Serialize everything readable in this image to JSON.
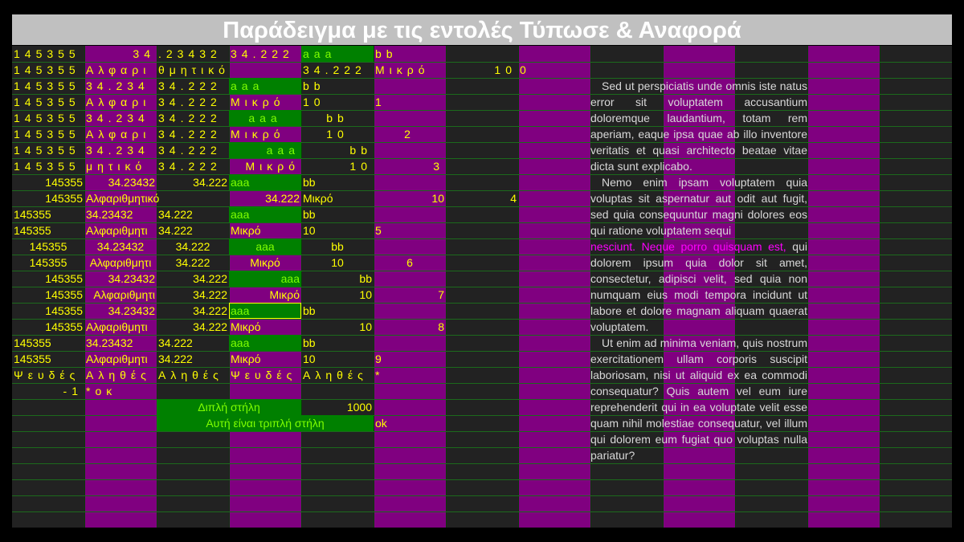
{
  "title": "Παράδειγμα με τις εντολές Τύπωσε & Αναφορά",
  "rows": [
    [
      {
        "c": 0,
        "t": "145355",
        "cls": "sp"
      },
      {
        "c": 1,
        "t": "34",
        "al": "r",
        "cls": "sp"
      },
      {
        "c": 2,
        "t": ".23432",
        "cls": "sp"
      },
      {
        "c": 3,
        "t": "34.222",
        "cls": "sp"
      },
      {
        "c": 4,
        "t": "aaa",
        "cls": "g sp"
      },
      {
        "c": 5,
        "t": "bb",
        "cls": "sp"
      }
    ],
    [
      {
        "c": 0,
        "t": "145355",
        "cls": "sp"
      },
      {
        "c": 1,
        "t": "Αλφαρι",
        "cls": "sp"
      },
      {
        "c": 2,
        "t": "θμητικό",
        "cls": "sp"
      },
      {
        "c": 4,
        "t": "34.222",
        "cls": "sp"
      },
      {
        "c": 5,
        "t": "Μικρό",
        "cls": "sp"
      },
      {
        "c": 6,
        "t": "10",
        "al": "r",
        "cls": "sp"
      },
      {
        "c": 7,
        "t": "0",
        "cls": "sp"
      }
    ],
    [
      {
        "c": 0,
        "t": "145355",
        "cls": "sp"
      },
      {
        "c": 1,
        "t": "34.234",
        "cls": "sp"
      },
      {
        "c": 2,
        "t": "34.222",
        "cls": "sp"
      },
      {
        "c": 3,
        "t": "aaa",
        "cls": "g sp"
      },
      {
        "c": 4,
        "t": "bb",
        "cls": "sp"
      }
    ],
    [
      {
        "c": 0,
        "t": "145355",
        "cls": "sp"
      },
      {
        "c": 1,
        "t": "Αλφαρι",
        "cls": "sp"
      },
      {
        "c": 2,
        "t": "34.222",
        "cls": "sp"
      },
      {
        "c": 3,
        "t": "Μικρό",
        "cls": "sp"
      },
      {
        "c": 4,
        "t": "10",
        "cls": "sp"
      },
      {
        "c": 5,
        "t": "1",
        "cls": "sp"
      }
    ],
    [
      {
        "c": 0,
        "t": "145355",
        "cls": "sp"
      },
      {
        "c": 1,
        "t": "34.234",
        "cls": "sp"
      },
      {
        "c": 2,
        "t": "34.222",
        "cls": "sp"
      },
      {
        "c": 3,
        "t": "aaa",
        "al": "c",
        "cls": "g sp"
      },
      {
        "c": 4,
        "t": "bb",
        "al": "c",
        "cls": "sp"
      }
    ],
    [
      {
        "c": 0,
        "t": "145355",
        "cls": "sp"
      },
      {
        "c": 1,
        "t": "Αλφαρι",
        "cls": "sp"
      },
      {
        "c": 2,
        "t": "34.222",
        "cls": "sp"
      },
      {
        "c": 3,
        "t": "Μικρό",
        "cls": "sp"
      },
      {
        "c": 4,
        "t": "10",
        "al": "c",
        "cls": "sp"
      },
      {
        "c": 5,
        "t": "2",
        "al": "c",
        "cls": "sp"
      }
    ],
    [
      {
        "c": 0,
        "t": "145355",
        "cls": "sp"
      },
      {
        "c": 1,
        "t": "34.234",
        "cls": "sp"
      },
      {
        "c": 2,
        "t": "34.222",
        "cls": "sp"
      },
      {
        "c": 3,
        "t": "aaa",
        "al": "r",
        "cls": "g sp"
      },
      {
        "c": 4,
        "t": "bb",
        "al": "r",
        "cls": "sp"
      }
    ],
    [
      {
        "c": 0,
        "t": "145355",
        "cls": "sp"
      },
      {
        "c": 1,
        "t": "μητικό",
        "cls": "sp"
      },
      {
        "c": 2,
        "t": "34.222",
        "cls": "sp"
      },
      {
        "c": 3,
        "t": "Μικρό",
        "al": "r",
        "cls": "sp"
      },
      {
        "c": 4,
        "t": "10",
        "al": "r",
        "cls": "sp"
      },
      {
        "c": 5,
        "t": "3",
        "al": "r",
        "cls": "sp"
      }
    ],
    [
      {
        "c": 0,
        "t": "145355",
        "al": "r"
      },
      {
        "c": 1,
        "t": "34.23432",
        "al": "r"
      },
      {
        "c": 2,
        "t": "34.222",
        "al": "r"
      },
      {
        "c": 3,
        "t": "aaa",
        "cls": "g"
      },
      {
        "c": 4,
        "t": "bb"
      }
    ],
    [
      {
        "c": 0,
        "t": "145355",
        "al": "r"
      },
      {
        "c": 1,
        "t": "Αλφαριθμητικό"
      },
      {
        "c": 3,
        "t": "34.222",
        "al": "r"
      },
      {
        "c": 4,
        "t": "Μικρό"
      },
      {
        "c": 5,
        "t": "10",
        "al": "r"
      },
      {
        "c": 6,
        "t": "4",
        "al": "r"
      }
    ],
    [
      {
        "c": 0,
        "t": "145355"
      },
      {
        "c": 1,
        "t": "34.23432"
      },
      {
        "c": 2,
        "t": "34.222"
      },
      {
        "c": 3,
        "t": "aaa",
        "cls": "g"
      },
      {
        "c": 4,
        "t": "bb"
      }
    ],
    [
      {
        "c": 0,
        "t": "145355"
      },
      {
        "c": 1,
        "t": "Αλφαριθμητι"
      },
      {
        "c": 2,
        "t": "34.222"
      },
      {
        "c": 3,
        "t": "Μικρό"
      },
      {
        "c": 4,
        "t": "10"
      },
      {
        "c": 5,
        "t": "5"
      }
    ],
    [
      {
        "c": 0,
        "t": "145355",
        "al": "c"
      },
      {
        "c": 1,
        "t": "34.23432",
        "al": "c"
      },
      {
        "c": 2,
        "t": "34.222",
        "al": "c"
      },
      {
        "c": 3,
        "t": "aaa",
        "al": "c",
        "cls": "g"
      },
      {
        "c": 4,
        "t": "bb",
        "al": "c"
      }
    ],
    [
      {
        "c": 0,
        "t": "145355",
        "al": "c"
      },
      {
        "c": 1,
        "t": "Αλφαριθμητι",
        "al": "c"
      },
      {
        "c": 2,
        "t": "34.222",
        "al": "c"
      },
      {
        "c": 3,
        "t": "Μικρό",
        "al": "c"
      },
      {
        "c": 4,
        "t": "10",
        "al": "c"
      },
      {
        "c": 5,
        "t": "6",
        "al": "c"
      }
    ],
    [
      {
        "c": 0,
        "t": "145355",
        "al": "r"
      },
      {
        "c": 1,
        "t": "34.23432",
        "al": "r"
      },
      {
        "c": 2,
        "t": "34.222",
        "al": "r"
      },
      {
        "c": 3,
        "t": "aaa",
        "al": "r",
        "cls": "g"
      },
      {
        "c": 4,
        "t": "bb",
        "al": "r"
      }
    ],
    [
      {
        "c": 0,
        "t": "145355",
        "al": "r"
      },
      {
        "c": 1,
        "t": "Αλφαριθμητι",
        "al": "r"
      },
      {
        "c": 2,
        "t": "34.222",
        "al": "r"
      },
      {
        "c": 3,
        "t": "Μικρό",
        "al": "r"
      },
      {
        "c": 4,
        "t": "10",
        "al": "r"
      },
      {
        "c": 5,
        "t": "7",
        "al": "r"
      }
    ],
    [
      {
        "c": 0,
        "t": "145355",
        "al": "r"
      },
      {
        "c": 1,
        "t": "34.23432",
        "al": "r"
      },
      {
        "c": 2,
        "t": "34.222",
        "al": "r"
      },
      {
        "c": 3,
        "t": "aaa",
        "cls": "g bx"
      },
      {
        "c": 4,
        "t": "bb"
      }
    ],
    [
      {
        "c": 0,
        "t": "145355",
        "al": "r"
      },
      {
        "c": 1,
        "t": "Αλφαριθμητι"
      },
      {
        "c": 2,
        "t": "34.222",
        "al": "r"
      },
      {
        "c": 3,
        "t": "Μικρό"
      },
      {
        "c": 4,
        "t": "10",
        "al": "r"
      },
      {
        "c": 5,
        "t": "8",
        "al": "r"
      }
    ],
    [
      {
        "c": 0,
        "t": "145355"
      },
      {
        "c": 1,
        "t": "34.23432"
      },
      {
        "c": 2,
        "t": "34.222"
      },
      {
        "c": 3,
        "t": "aaa",
        "cls": "g"
      },
      {
        "c": 4,
        "t": "bb"
      }
    ],
    [
      {
        "c": 0,
        "t": "145355"
      },
      {
        "c": 1,
        "t": "Αλφαριθμητι"
      },
      {
        "c": 2,
        "t": "34.222"
      },
      {
        "c": 3,
        "t": "Μικρό"
      },
      {
        "c": 4,
        "t": "10"
      },
      {
        "c": 5,
        "t": "9"
      }
    ],
    [
      {
        "c": 0,
        "t": "Ψευδές",
        "cls": "sp"
      },
      {
        "c": 1,
        "t": "Αληθές",
        "cls": "sp"
      },
      {
        "c": 2,
        "t": "Αληθές",
        "cls": "sp"
      },
      {
        "c": 3,
        "t": "Ψευδές",
        "cls": "sp"
      },
      {
        "c": 4,
        "t": "Αληθές",
        "cls": "sp"
      },
      {
        "c": 5,
        "t": "*"
      }
    ],
    [
      {
        "c": 0,
        "t": "-1",
        "al": "r",
        "cls": "sp"
      },
      {
        "c": 1,
        "t": "*οκ",
        "cls": "sp"
      }
    ],
    [
      {
        "c": 2,
        "span": 2,
        "t": "Διπλή στήλη",
        "al": "c",
        "cls": "gl"
      },
      {
        "c": 4,
        "t": "1000",
        "al": "r"
      }
    ],
    [
      {
        "c": 2,
        "span": 3,
        "t": "Αυτή είναι τριπλή στήλη",
        "al": "c",
        "cls": "gl"
      },
      {
        "c": 5,
        "t": "ok"
      }
    ]
  ],
  "paragraphs": [
    {
      "text": "Sed ut perspiciatis unde omnis iste natus error sit voluptatem accusantium doloremque laudantium, totam rem aperiam, eaque ipsa quae ab illo inventore veritatis et quasi architecto beatae vitae dicta sunt explicabo."
    },
    {
      "text": "Nemo enim ipsam voluptatem quia voluptas sit aspernatur aut odit aut fugit, sed quia consequuntur magni dolores eos qui ratione voluptatem sequi"
    },
    {
      "magenta": "nesciunt. Neque porro quisquam est,",
      "text": " qui dolorem ipsum quia dolor sit amet, consectetur, adipisci velit, sed quia non numquam eius modi tempora incidunt ut labore et dolore magnam aliquam quaerat voluptatem."
    },
    {
      "text": "Ut enim ad minima veniam, quis nostrum exercitationem ullam corporis suscipit laboriosam, nisi ut aliquid ex ea commodi consequatur? Quis autem vel eum iure reprehenderit qui in ea voluptate velit esse quam nihil molestiae consequatur, vel illum qui dolorem eum fugiat quo voluptas nulla pariatur?"
    }
  ],
  "colors": {
    "title_bg": "#c0c0c0",
    "grid_bg": "#222222",
    "purple": "#800080",
    "green": "#008000",
    "text_yellow": "#ffff00",
    "text_green": "#7fff00",
    "magenta": "#ff00ff"
  }
}
